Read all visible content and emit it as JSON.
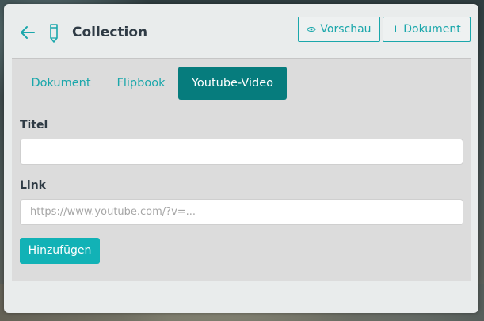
{
  "header": {
    "title": "Collection",
    "back_icon": "arrow-left-icon",
    "title_icon": "pencil-icon",
    "preview_button": {
      "icon": "eye-icon",
      "label": "Vorschau"
    },
    "add_document_button": {
      "icon": "plus-icon",
      "label": "Dokument"
    }
  },
  "tabs": [
    {
      "label": "Dokument",
      "active": false
    },
    {
      "label": "Flipbook",
      "active": false
    },
    {
      "label": "Youtube-Video",
      "active": true
    }
  ],
  "form": {
    "title_label": "Titel",
    "title_value": "",
    "title_placeholder": "",
    "link_label": "Link",
    "link_value": "",
    "link_placeholder": "https://www.youtube.com/?v=...",
    "submit_label": "Hinzufügen"
  },
  "colors": {
    "accent": "#1aa7ab",
    "active_tab": "#067c7d",
    "submit": "#12b2b6",
    "panel_bg": "#dcdcdc",
    "card_bg": "#e9ecec"
  }
}
